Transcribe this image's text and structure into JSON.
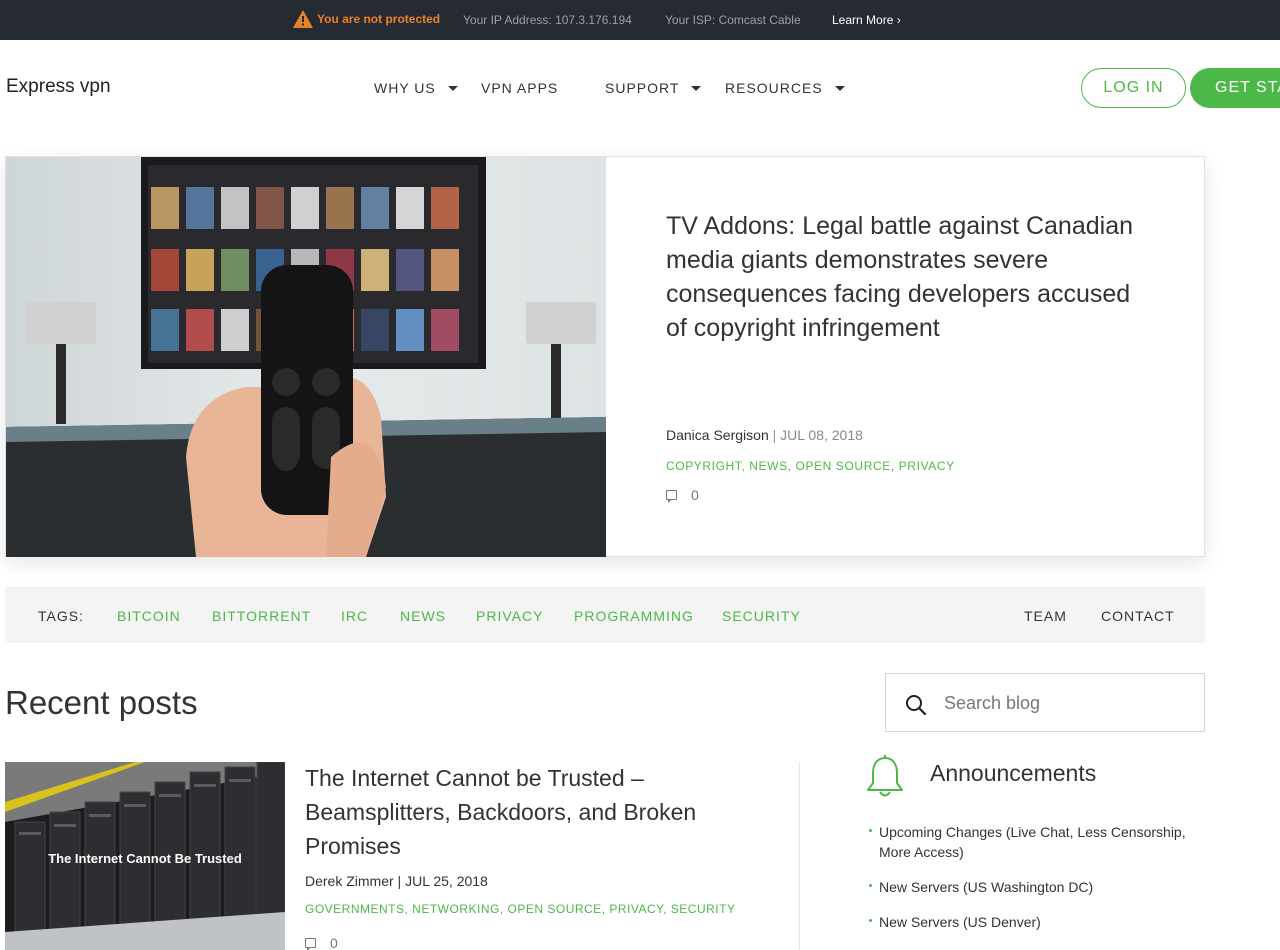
{
  "alert_bar": {
    "warning": "You are not protected",
    "ip_address": "Your IP Address: 107.3.176.194",
    "isp": "Your ISP: Comcast Cable",
    "learn_more": "Learn More ›"
  },
  "header": {
    "logo": "Express vpn",
    "nav": [
      {
        "label": "WHY US",
        "dropdown": true
      },
      {
        "label": "VPN APPS",
        "dropdown": false
      },
      {
        "label": "SUPPORT",
        "dropdown": true
      },
      {
        "label": "RESOURCES",
        "dropdown": true
      }
    ],
    "login_label": "LOG IN",
    "get_started_label": "GET STA"
  },
  "featured": {
    "title": "TV Addons: Legal battle against Canadian media giants demonstrates severe consequences facing developers accused of copyright infringement",
    "author": "Danica Sergison",
    "separator": "|",
    "date": "JUL 08, 2018",
    "categories": "COPYRIGHT, NEWS, OPEN SOURCE, PRIVACY",
    "comments": "0",
    "image_icon": "tv-remote-photo"
  },
  "tags_bar": {
    "label": "TAGS:",
    "tags": [
      "BITCOIN",
      "BITTORRENT",
      "IRC",
      "NEWS",
      "PRIVACY",
      "PROGRAMMING",
      "SECURITY"
    ],
    "links": [
      "TEAM",
      "CONTACT"
    ]
  },
  "recent": {
    "heading": "Recent posts",
    "search_placeholder": "Search blog",
    "posts": [
      {
        "title": "The Internet Cannot be Trusted – Beamsplitters, Backdoors, and Broken Promises",
        "author_date": "Derek Zimmer | JUL 25, 2018",
        "categories": "GOVERNMENTS, NETWORKING, OPEN SOURCE, PRIVACY, SECURITY",
        "comments": "0",
        "image_caption": "The Internet Cannot Be Trusted"
      }
    ]
  },
  "announcements": {
    "heading": "Announcements",
    "icon": "bell-icon",
    "items": [
      "Upcoming Changes (Live Chat, Less Censorship, More Access)",
      "New Servers (US Washington DC)",
      "New Servers (US Denver)"
    ]
  },
  "colors": {
    "accent": "#4cb848",
    "warning": "#e8822a",
    "topbar": "#262a33"
  }
}
